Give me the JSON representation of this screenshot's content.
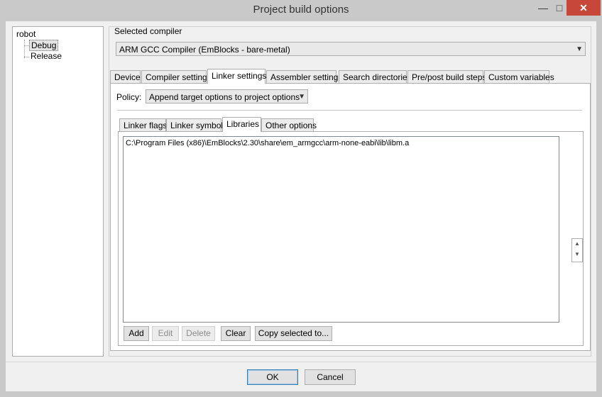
{
  "window": {
    "title": "Project build options",
    "minimize": "—",
    "maximize": "□",
    "close": "✕"
  },
  "tree": {
    "root": "robot",
    "items": [
      "Debug",
      "Release"
    ]
  },
  "compiler": {
    "label": "Selected compiler",
    "value": "ARM GCC Compiler (EmBlocks - bare-metal)"
  },
  "main_tabs": [
    "Device",
    "Compiler settings",
    "Linker settings",
    "Assembler settings",
    "Search directories",
    "Pre/post build steps",
    "Custom variables"
  ],
  "policy": {
    "label": "Policy:",
    "value": "Append target options to project options"
  },
  "sub_tabs": [
    "Linker flags",
    "Linker symbols",
    "Libraries",
    "Other options"
  ],
  "libraries": [
    "C:\\Program Files (x86)\\EmBlocks\\2.30\\share\\em_armgcc\\arm-none-eabi\\lib\\libm.a"
  ],
  "lib_buttons": {
    "add": "Add",
    "edit": "Edit",
    "delete": "Delete",
    "clear": "Clear",
    "copy": "Copy selected to..."
  },
  "dialog_buttons": {
    "ok": "OK",
    "cancel": "Cancel"
  },
  "colors": {
    "close_button": "#c7473a",
    "titlebar": "#c9c9c9",
    "default_button_border": "#3c7fb1"
  }
}
